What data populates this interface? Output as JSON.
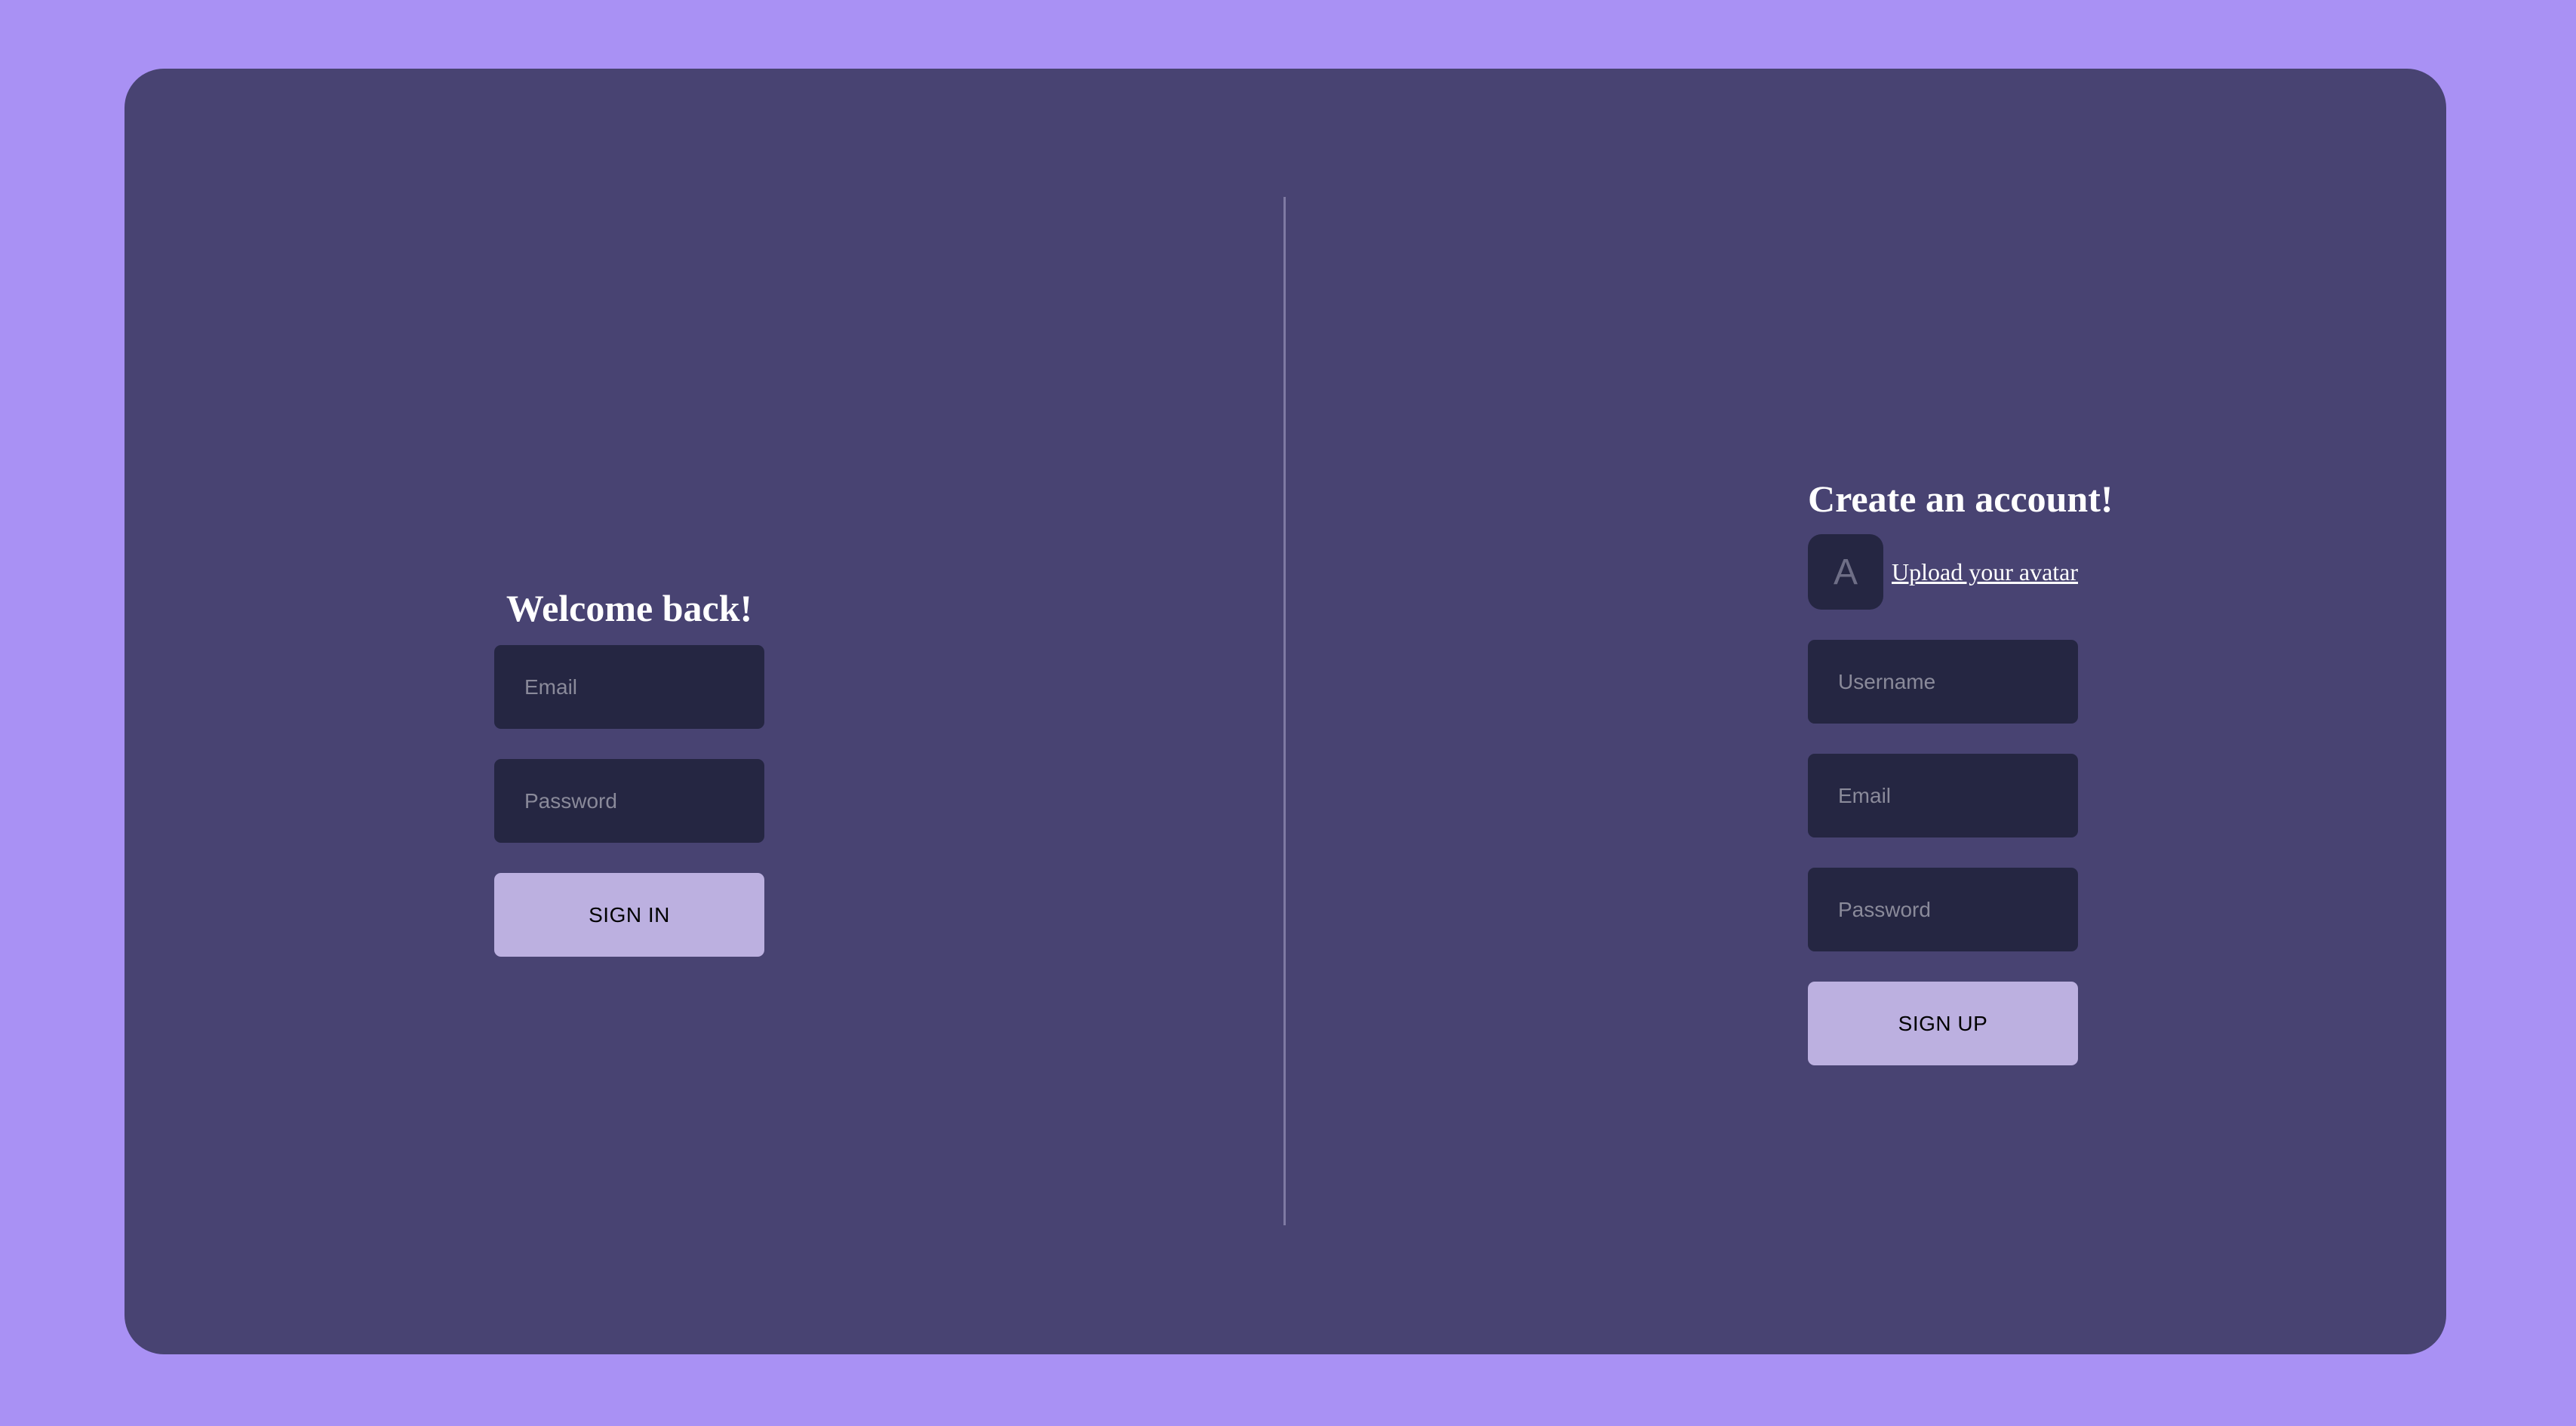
{
  "login": {
    "title": "Welcome back!",
    "email_placeholder": "Email",
    "password_placeholder": "Password",
    "submit_label": "SIGN IN"
  },
  "signup": {
    "title": "Create an account!",
    "avatar_letter": "A",
    "upload_label": "Upload your avatar",
    "username_placeholder": "Username",
    "email_placeholder": "Email",
    "password_placeholder": "Password",
    "submit_label": "SIGN UP"
  },
  "colors": {
    "page_background": "#a991f4",
    "panel_background": "#484372",
    "field_background": "#252642",
    "button_background": "#bcb0e0",
    "divider": "#7f7aa3"
  }
}
